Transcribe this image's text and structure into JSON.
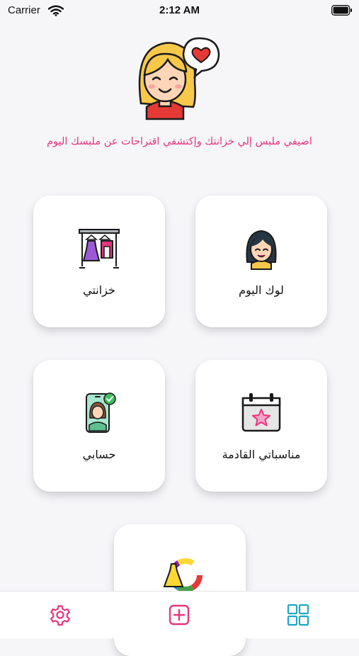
{
  "status_bar": {
    "carrier": "Carrier",
    "time": "2:12 AM"
  },
  "header": {
    "tagline": "اضيفي ملبس إلي خزانتك وإكتشفي اقتراحات عن ملبسك اليوم"
  },
  "cards": {
    "closet": {
      "label": "خزانتي",
      "icon": "wardrobe-rack-icon"
    },
    "look": {
      "label": "لوك اليوم",
      "icon": "girl-avatar-icon"
    },
    "account": {
      "label": "حسابي",
      "icon": "profile-phone-icon"
    },
    "events": {
      "label": "مناسباتي القادمة",
      "icon": "calendar-star-icon"
    },
    "colors": {
      "label": "",
      "icon": "dress-color-wheel-icon"
    }
  },
  "tabbar": {
    "settings_icon": "gear-icon",
    "add_icon": "plus-square-icon",
    "grid_icon": "grid-icon"
  },
  "colors": {
    "accent": "#e8357f",
    "tab_teal": "#1ba8c4",
    "background": "#f6f6f9"
  }
}
